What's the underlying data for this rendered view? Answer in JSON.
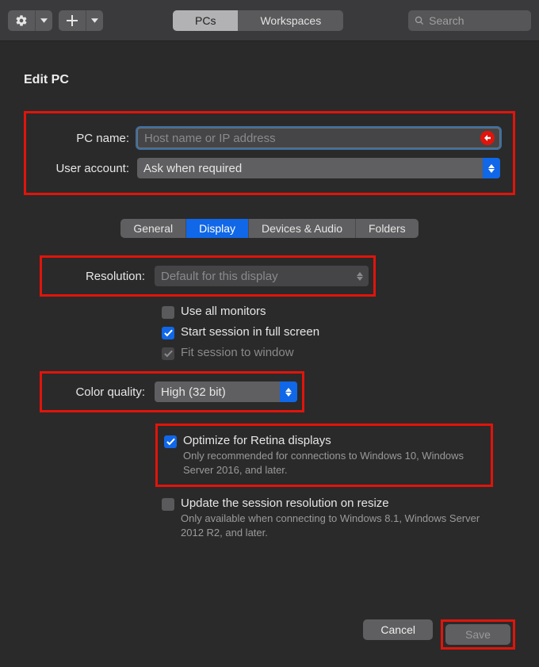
{
  "toolbar": {
    "segments": {
      "pcs": "PCs",
      "workspaces": "Workspaces"
    },
    "search_placeholder": "Search"
  },
  "sheet": {
    "title": "Edit PC",
    "pc_name_label": "PC name:",
    "pc_name_placeholder": "Host name or IP address",
    "user_account_label": "User account:",
    "user_account_value": "Ask when required",
    "tabs": {
      "general": "General",
      "display": "Display",
      "devices": "Devices & Audio",
      "folders": "Folders"
    },
    "resolution_label": "Resolution:",
    "resolution_value": "Default for this display",
    "checks": {
      "use_all_monitors": "Use all monitors",
      "full_screen": "Start session in full screen",
      "fit_window": "Fit session to window"
    },
    "color_quality_label": "Color quality:",
    "color_quality_value": "High (32 bit)",
    "retina": {
      "label": "Optimize for Retina displays",
      "sub": "Only recommended for connections to Windows 10, Windows Server 2016, and later."
    },
    "update_res": {
      "label": "Update the session resolution on resize",
      "sub": "Only available when connecting to Windows 8.1, Windows Server 2012 R2, and later."
    },
    "cancel": "Cancel",
    "save": "Save"
  }
}
